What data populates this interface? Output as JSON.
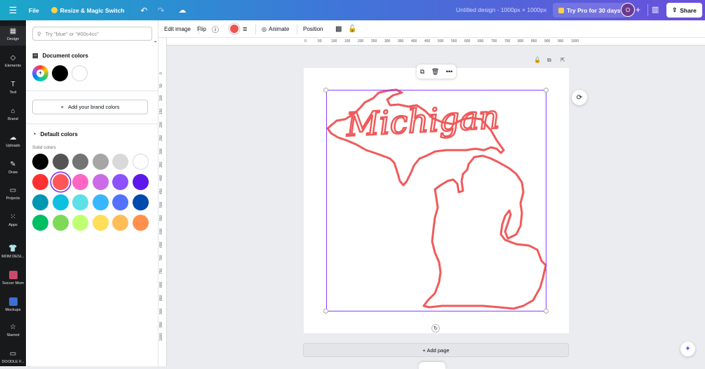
{
  "topbar": {
    "file_label": "File",
    "resize_label": "Resize & Magic Switch",
    "title": "Untitled design - 1000px × 1000px",
    "pro_label": "Try Pro for 30 days",
    "avatar_initial": "O",
    "share_label": "Share"
  },
  "sidenav": {
    "items": [
      {
        "label": "Design",
        "icon": "design-icon"
      },
      {
        "label": "Elements",
        "icon": "elements-icon"
      },
      {
        "label": "Text",
        "icon": "text-icon"
      },
      {
        "label": "Brand",
        "icon": "brand-icon"
      },
      {
        "label": "Uploads",
        "icon": "uploads-icon"
      },
      {
        "label": "Draw",
        "icon": "draw-icon"
      },
      {
        "label": "Projects",
        "icon": "projects-icon"
      },
      {
        "label": "Apps",
        "icon": "apps-icon"
      },
      {
        "label": "MOM DESI...",
        "icon": "shirt-icon"
      },
      {
        "label": "Soccer Mom",
        "icon": "app-thumb-icon"
      },
      {
        "label": "Mockups",
        "icon": "mockups-icon"
      },
      {
        "label": "Starred",
        "icon": "star-icon"
      },
      {
        "label": "DOODLE F...",
        "icon": "folder-icon"
      }
    ]
  },
  "panel": {
    "search_placeholder": "Try \"blue\" or \"#00c4cc\"",
    "document_colors_title": "Document colors",
    "document_colors": [
      "#000000",
      "#ffffff"
    ],
    "add_brand_label": "Add your brand colors",
    "default_colors_title": "Default colors",
    "solid_colors_label": "Solid colors",
    "solid_colors": [
      [
        "#000000",
        "#545454",
        "#737373",
        "#a6a6a6",
        "#d9d9d9",
        "#ffffff"
      ],
      [
        "#ff3131",
        "#ff5757",
        "#ff66c4",
        "#cb6ce6",
        "#8c52ff",
        "#5e17eb"
      ],
      [
        "#0097b2",
        "#0cc0df",
        "#5ce1e6",
        "#38b6ff",
        "#5271ff",
        "#004aad"
      ],
      [
        "#00bf63",
        "#7ed957",
        "#c1ff72",
        "#ffde59",
        "#ffbd59",
        "#ff914d"
      ]
    ],
    "selected_color": "#ff5757"
  },
  "context_bar": {
    "edit_image": "Edit image",
    "flip": "Flip",
    "animate": "Animate",
    "position": "Position",
    "stroke_color": "#ef5350"
  },
  "rulers": {
    "top": [
      "0",
      "50",
      "100",
      "150",
      "200",
      "250",
      "300",
      "350",
      "400",
      "450",
      "500",
      "550",
      "600",
      "650",
      "700",
      "750",
      "800",
      "850",
      "900",
      "950",
      "1000"
    ],
    "left": [
      "0",
      "50",
      "100",
      "150",
      "200",
      "250",
      "300",
      "350",
      "400",
      "450",
      "500",
      "550",
      "600",
      "650",
      "700",
      "750",
      "800",
      "850",
      "900",
      "950",
      "1000"
    ]
  },
  "canvas": {
    "script_text": "Michigan",
    "outline_color": "#f05a5a"
  },
  "add_page_label": "+ Add page"
}
